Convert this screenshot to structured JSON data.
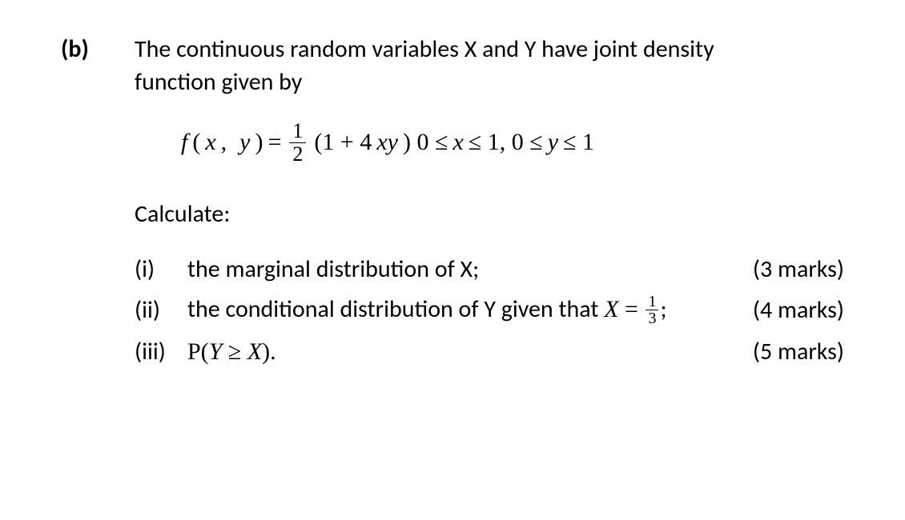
{
  "question": {
    "label": "(b)",
    "intro_line1": "The continuous random variables X and Y have joint density",
    "intro_line2": "function given by",
    "formula": {
      "lhs_f": "f",
      "lhs_args_open": "(",
      "lhs_x": "x",
      "lhs_comma": ",",
      "lhs_y": "y",
      "lhs_args_close": ")",
      "eq": " = ",
      "frac_num": "1",
      "frac_den": "2",
      "open": "(1 + 4",
      "xy": "xy",
      "close": " )  0 ≤ ",
      "xvar": "x",
      "mid": " ≤ 1, 0 ≤ ",
      "yvar": "y",
      "end": " ≤ 1"
    },
    "calculate": "Calculate:",
    "items": [
      {
        "roman": "(i)",
        "text": "the marginal distribution of X;",
        "marks": "(3 marks)"
      },
      {
        "roman": "(ii)",
        "prefix": "the conditional distribution of Y given that ",
        "math_X": "X",
        "math_eq": " = ",
        "frac_num": "1",
        "frac_den": "3",
        "suffix": ";",
        "marks": "(4 marks)"
      },
      {
        "roman": "(iii)",
        "math": "P(Y ≥ X).",
        "marks": "(5 marks)"
      }
    ]
  }
}
